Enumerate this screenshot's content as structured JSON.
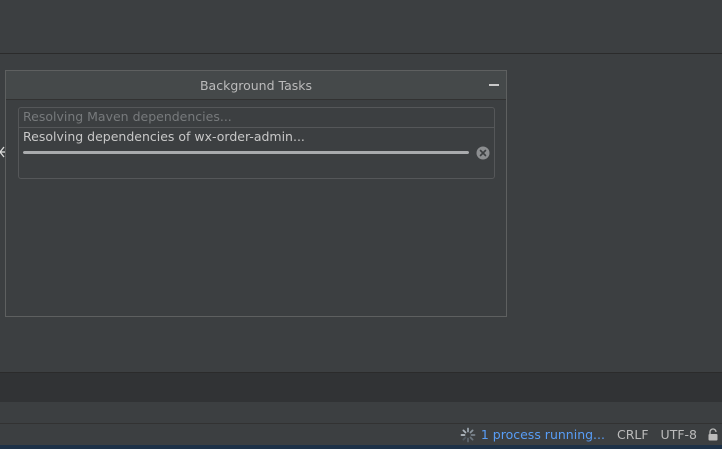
{
  "popup": {
    "title": "Background Tasks",
    "task_group_label": "Resolving Maven dependencies...",
    "task_label": "Resolving dependencies of wx-order-admin...",
    "task_progress": 1.0
  },
  "status_bar": {
    "process_text": "1 process running...",
    "line_separator": "CRLF",
    "encoding": "UTF-8"
  },
  "colors": {
    "background": "#3c3f41",
    "link": "#589df6",
    "text": "#bbbbbb"
  },
  "icons": [
    "minimize-icon",
    "cancel-icon",
    "spinner-icon",
    "lock-icon",
    "cursor-icon"
  ]
}
